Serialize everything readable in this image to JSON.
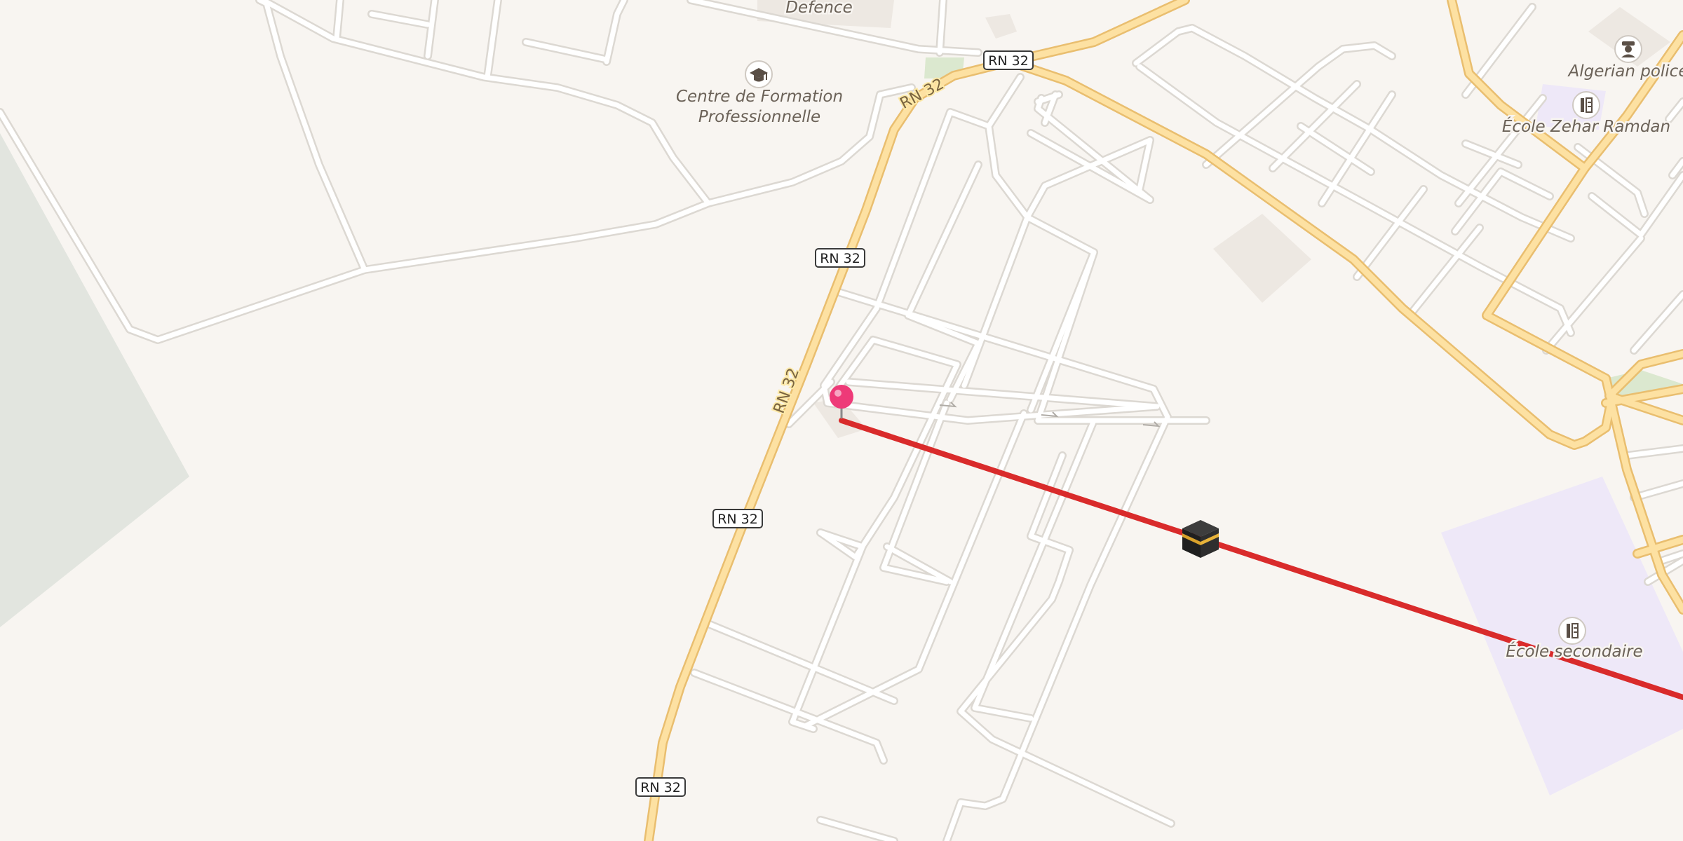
{
  "map": {
    "colors": {
      "background": "#f8f5f1",
      "minor_road": "#ffffff",
      "minor_road_casing": "#dcd8d2",
      "primary_road": "#fde1a2",
      "primary_road_casing": "#e9be6f",
      "qibla_line": "#d92b2b",
      "green_area": "#e2e5df",
      "school_area": "#eee8f8",
      "marker": "#ee3a78"
    },
    "road_shields": [
      {
        "id": "shield-1",
        "text": "RN 32"
      },
      {
        "id": "shield-2",
        "text": "RN 32"
      },
      {
        "id": "shield-3",
        "text": "RN 32"
      },
      {
        "id": "shield-4",
        "text": "RN 32"
      }
    ],
    "road_labels": [
      {
        "id": "road-label-1",
        "text": "RN 32"
      },
      {
        "id": "road-label-2",
        "text": "RN 32"
      }
    ],
    "pois": [
      {
        "id": "poi-defence",
        "label": "Defence",
        "icon": "none"
      },
      {
        "id": "poi-centre-formation",
        "label_line1": "Centre de Formation",
        "label_line2": "Professionnelle",
        "icon": "graduation-cap-icon"
      },
      {
        "id": "poi-algerian-police",
        "label": "Algerian police",
        "icon": "police-officer-icon"
      },
      {
        "id": "poi-ecole-zehar",
        "label": "École Zehar Ramdan",
        "icon": "school-icon"
      },
      {
        "id": "poi-ecole-secondaire",
        "label": "École secondaire",
        "icon": "school-icon"
      }
    ],
    "markers": {
      "location_pin": {
        "icon": "map-pin-icon"
      },
      "kaaba": {
        "icon": "kaaba-icon"
      }
    }
  }
}
